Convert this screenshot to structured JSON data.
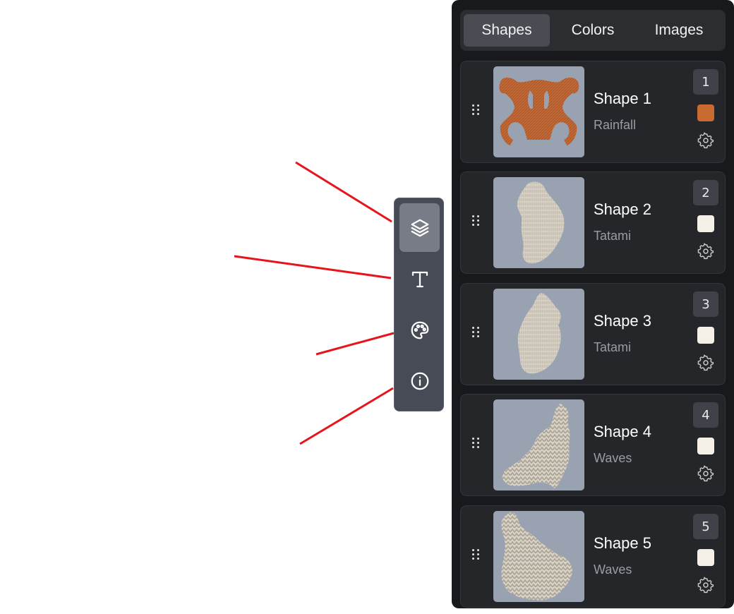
{
  "colors": {
    "panel_bg": "#18191c",
    "card_bg": "#24262a",
    "thumb_bg": "#99a2b1",
    "toolbar_bg": "#464b55",
    "pointer_line": "#e8141b"
  },
  "toolbar": {
    "tools": [
      {
        "icon": "layers-icon",
        "active": true
      },
      {
        "icon": "text-icon",
        "active": false
      },
      {
        "icon": "palette-icon",
        "active": false
      },
      {
        "icon": "info-icon",
        "active": false
      }
    ]
  },
  "tabs": [
    {
      "label": "Shapes",
      "active": true
    },
    {
      "label": "Colors",
      "active": false
    },
    {
      "label": "Images",
      "active": false
    }
  ],
  "shapes": [
    {
      "name": "Shape 1",
      "fill": "Rainfall",
      "index": "1",
      "color": "#c96a30"
    },
    {
      "name": "Shape 2",
      "fill": "Tatami",
      "index": "2",
      "color": "#f4f0e8"
    },
    {
      "name": "Shape 3",
      "fill": "Tatami",
      "index": "3",
      "color": "#f4f0e8"
    },
    {
      "name": "Shape 4",
      "fill": "Waves",
      "index": "4",
      "color": "#f4f0e8"
    },
    {
      "name": "Shape 5",
      "fill": "Waves",
      "index": "5",
      "color": "#f4f0e8"
    }
  ]
}
